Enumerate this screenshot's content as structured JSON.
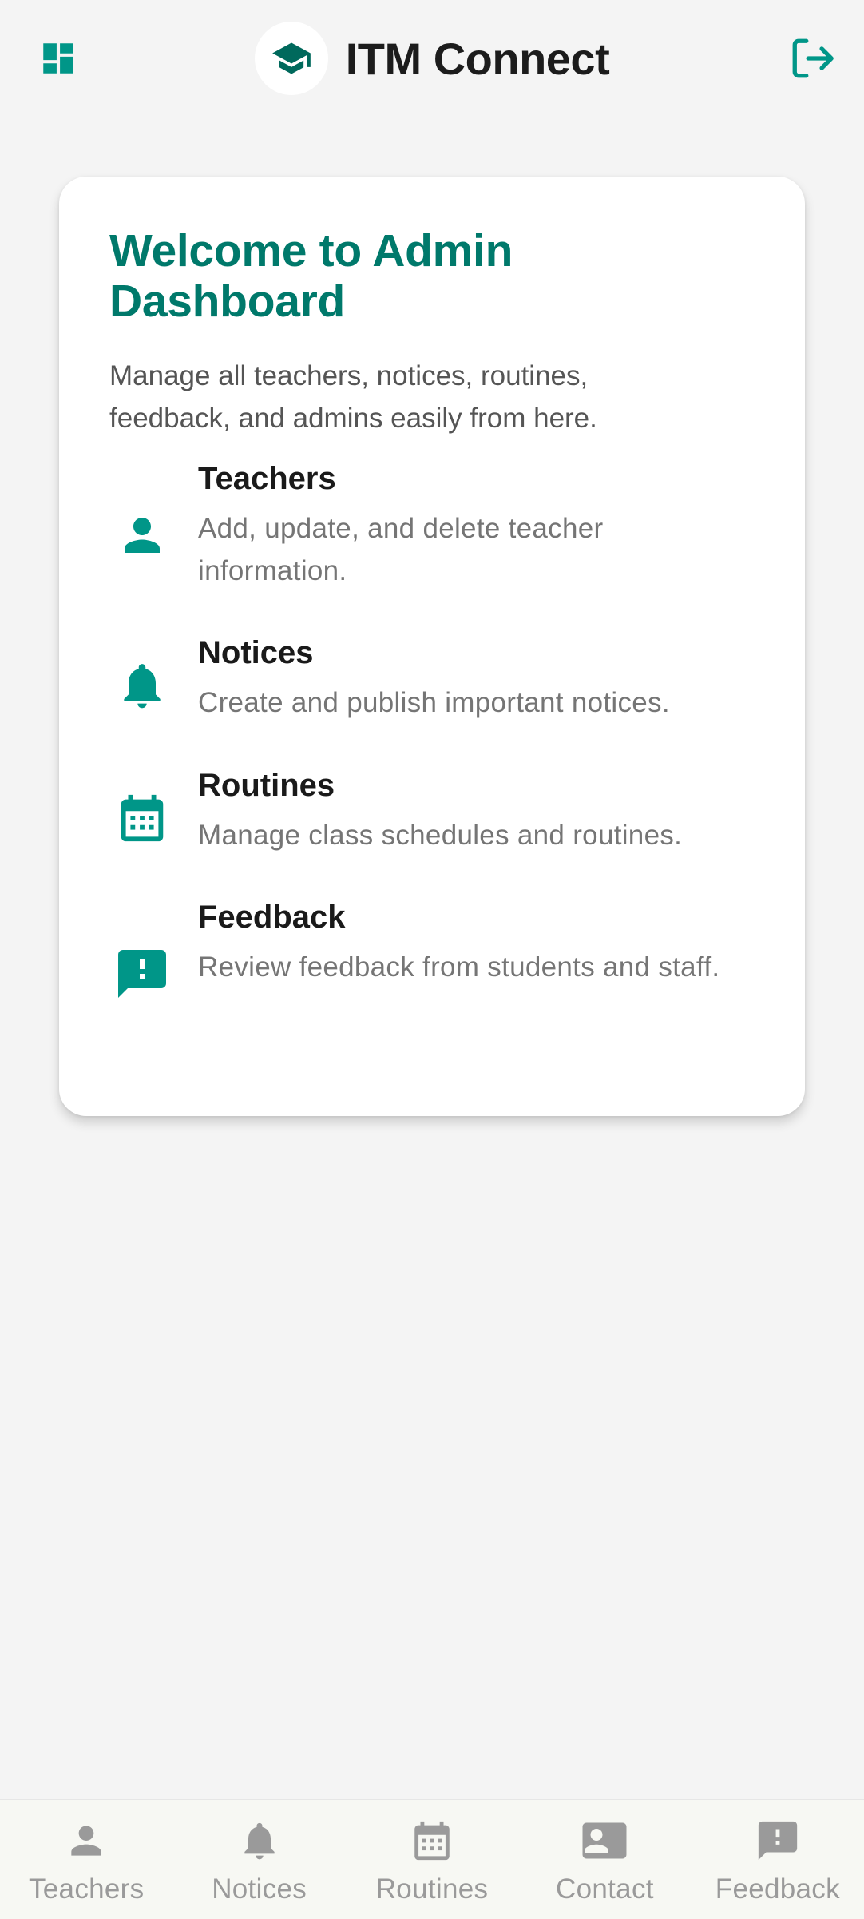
{
  "app": {
    "title": "ITM Connect"
  },
  "colors": {
    "accent": "#009688",
    "heading": "#00796b",
    "logo_icon": "#00695c",
    "nav_inactive": "#9a9a9a"
  },
  "header": {
    "menu_icon": "dashboard-icon",
    "logo_icon": "graduation-cap-icon",
    "logout_icon": "logout-icon"
  },
  "card": {
    "heading": "Welcome to Admin Dashboard",
    "intro": "Manage all teachers, notices, routines, feedback, and admins easily from here.",
    "features": [
      {
        "icon": "person-icon",
        "title": "Teachers",
        "description": "Add, update, and delete teacher information."
      },
      {
        "icon": "bell-icon",
        "title": "Notices",
        "description": "Create and publish important notices."
      },
      {
        "icon": "calendar-icon",
        "title": "Routines",
        "description": "Manage class schedules and routines."
      },
      {
        "icon": "feedback-icon",
        "title": "Feedback",
        "description": "Review feedback from students and staff."
      }
    ]
  },
  "bottom_nav": {
    "items": [
      {
        "icon": "person-icon",
        "label": "Teachers"
      },
      {
        "icon": "bell-icon",
        "label": "Notices"
      },
      {
        "icon": "calendar-icon",
        "label": "Routines"
      },
      {
        "icon": "contact-card-icon",
        "label": "Contact"
      },
      {
        "icon": "feedback-icon",
        "label": "Feedback"
      }
    ]
  }
}
